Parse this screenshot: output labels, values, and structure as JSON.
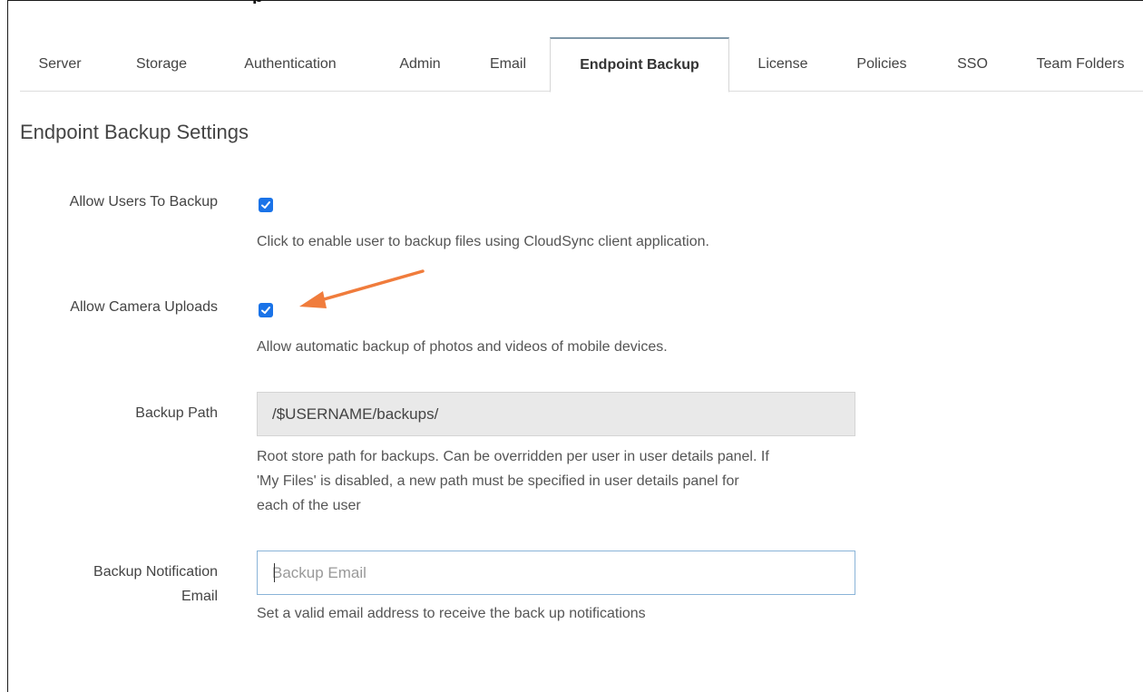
{
  "heading_fragment": "p",
  "tabs": [
    {
      "label": "Server",
      "active": false
    },
    {
      "label": "Storage",
      "active": false
    },
    {
      "label": "Authentication",
      "active": false
    },
    {
      "label": "Admin",
      "active": false
    },
    {
      "label": "Email",
      "active": false
    },
    {
      "label": "Endpoint Backup",
      "active": true
    },
    {
      "label": "License",
      "active": false
    },
    {
      "label": "Policies",
      "active": false
    },
    {
      "label": "SSO",
      "active": false
    },
    {
      "label": "Team Folders",
      "active": false
    }
  ],
  "page_title": "Endpoint Backup Settings",
  "settings": {
    "allow_backup": {
      "label": "Allow Users To Backup",
      "checked": true,
      "help": "Click to enable user to backup files using CloudSync client application."
    },
    "allow_camera": {
      "label": "Allow Camera Uploads",
      "checked": true,
      "help": "Allow automatic backup of photos and videos of mobile devices."
    },
    "backup_path": {
      "label": "Backup Path",
      "value": "/$USERNAME/backups/",
      "help_lines": [
        "Root store path for backups. Can be overridden per user in user details panel. If",
        "'My Files' is disabled, a new path must be specified in user details panel for",
        "each of the user"
      ]
    },
    "notification_email": {
      "label_lines": [
        "Backup Notification",
        "Email"
      ],
      "placeholder": "Backup Email",
      "help": "Set a valid email address to receive the back up notifications"
    }
  },
  "colors": {
    "checkbox": "#1a73e8",
    "annotation_arrow": "#f07c3c",
    "active_tab_top_border": "#7f97a8"
  },
  "icons": {
    "checkmark": "check-icon",
    "annotation": "orange-arrow-icon"
  }
}
